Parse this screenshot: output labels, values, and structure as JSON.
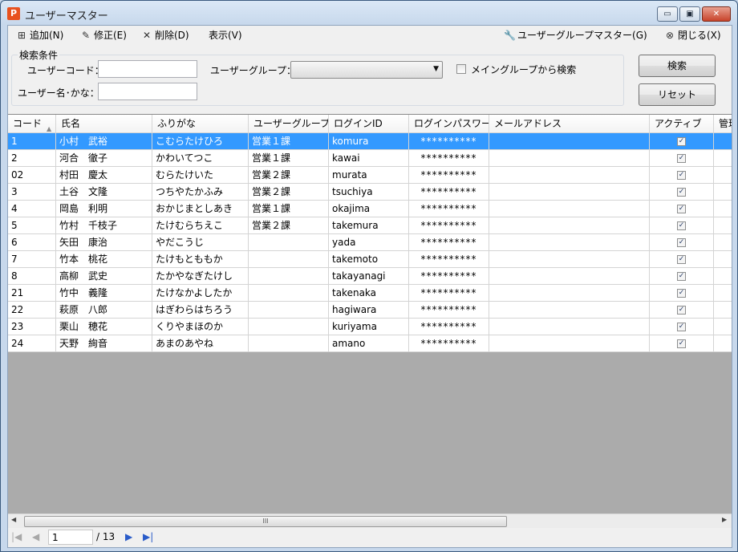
{
  "window": {
    "title": "ユーザーマスター",
    "app_icon_text": "P",
    "minimize_glyph": "▭",
    "maximize_glyph": "▣",
    "close_glyph": "✕"
  },
  "menu": {
    "add": "追加(N)",
    "edit": "修正(E)",
    "delete": "削除(D)",
    "view": "表示(V)",
    "group_master": "ユーザーグループマスター(G)",
    "close": "閉じる(X)"
  },
  "search": {
    "title": "検索条件",
    "user_code_label": "ユーザーコード：",
    "user_name_label": "ユーザー名･かな：",
    "user_group_label": "ユーザーグループ：",
    "main_group_check_label": "メイングループから検索",
    "search_button": "検索",
    "reset_button": "リセット"
  },
  "grid": {
    "columns": [
      "コード",
      "氏名",
      "ふりがな",
      "ユーザーグループ",
      "ログインID",
      "ログインパスワード",
      "メールアドレス",
      "アクティブ",
      "管理"
    ],
    "rows": [
      {
        "code": "1",
        "name": "小村　武裕",
        "kana": "こむらたけひろ",
        "group": "営業１課",
        "login": "komura",
        "password": "**********",
        "email": "",
        "active": "✓",
        "selected": true
      },
      {
        "code": "2",
        "name": "河合　徹子",
        "kana": "かわいてつこ",
        "group": "営業１課",
        "login": "kawai",
        "password": "**********",
        "email": "",
        "active": "✓"
      },
      {
        "code": "02",
        "name": "村田　慶太",
        "kana": "むらたけいた",
        "group": "営業２課",
        "login": "murata",
        "password": "**********",
        "email": "",
        "active": "✓"
      },
      {
        "code": "3",
        "name": "土谷　文隆",
        "kana": "つちやたかふみ",
        "group": "営業２課",
        "login": "tsuchiya",
        "password": "**********",
        "email": "",
        "active": "✓"
      },
      {
        "code": "4",
        "name": "岡島　利明",
        "kana": "おかじまとしあき",
        "group": "営業１課",
        "login": "okajima",
        "password": "**********",
        "email": "",
        "active": "✓"
      },
      {
        "code": "5",
        "name": "竹村　千枝子",
        "kana": "たけむらちえこ",
        "group": "営業２課",
        "login": "takemura",
        "password": "**********",
        "email": "",
        "active": "✓"
      },
      {
        "code": "6",
        "name": "矢田　康治",
        "kana": "やだこうじ",
        "group": "",
        "login": "yada",
        "password": "**********",
        "email": "",
        "active": "✓"
      },
      {
        "code": "7",
        "name": "竹本　桃花",
        "kana": "たけもとももか",
        "group": "",
        "login": "takemoto",
        "password": "**********",
        "email": "",
        "active": "✓"
      },
      {
        "code": "8",
        "name": "高柳　武史",
        "kana": "たかやなぎたけし",
        "group": "",
        "login": "takayanagi",
        "password": "**********",
        "email": "",
        "active": "✓"
      },
      {
        "code": "21",
        "name": "竹中　義隆",
        "kana": "たけなかよしたか",
        "group": "",
        "login": "takenaka",
        "password": "**********",
        "email": "",
        "active": "✓"
      },
      {
        "code": "22",
        "name": "萩原　八郎",
        "kana": "はぎわらはちろう",
        "group": "",
        "login": "hagiwara",
        "password": "**********",
        "email": "",
        "active": "✓"
      },
      {
        "code": "23",
        "name": "栗山　穂花",
        "kana": "くりやまほのか",
        "group": "",
        "login": "kuriyama",
        "password": "**********",
        "email": "",
        "active": "✓"
      },
      {
        "code": "24",
        "name": "天野　絢音",
        "kana": "あまのあやね",
        "group": "",
        "login": "amano",
        "password": "**********",
        "email": "",
        "active": "✓"
      }
    ]
  },
  "scroll": {
    "thumb_glyph": "III",
    "left_arrow": "◀",
    "right_arrow": "▶"
  },
  "pager": {
    "current_page": "1",
    "total": "/ 13",
    "first": "|◀",
    "prev": "◀",
    "next": "▶",
    "last": "▶|"
  }
}
